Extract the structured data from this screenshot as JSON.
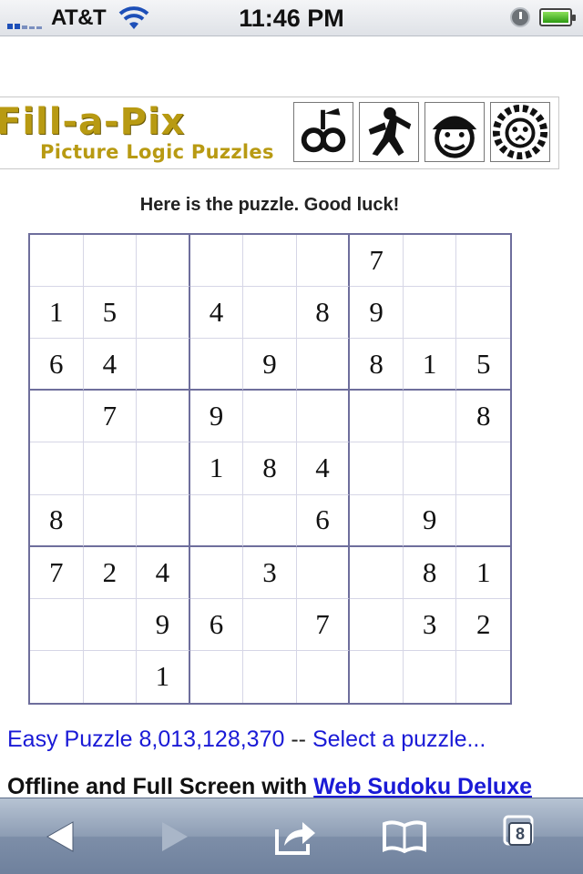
{
  "status_bar": {
    "carrier": "AT&T",
    "time": "11:46 PM",
    "signal_icon": "signal-bars-icon",
    "wifi_icon": "wifi-icon",
    "alarm_icon": "alarm-clock-icon",
    "battery_icon": "battery-icon",
    "battery_level": 1.0
  },
  "banner": {
    "logo_title": "Fill-a-Pix",
    "logo_subtitle": "Picture Logic Puzzles",
    "thumbnails": [
      "puzzle-thumb-fruit",
      "puzzle-thumb-figure",
      "puzzle-thumb-face",
      "puzzle-thumb-lion"
    ]
  },
  "intro_text": "Here is the puzzle. Good luck!",
  "sudoku": {
    "rows": [
      [
        "",
        "",
        "",
        "",
        "",
        "",
        "7",
        "",
        ""
      ],
      [
        "1",
        "5",
        "",
        "4",
        "",
        "8",
        "9",
        "",
        ""
      ],
      [
        "6",
        "4",
        "",
        "",
        "9",
        "",
        "8",
        "1",
        "5"
      ],
      [
        "",
        "7",
        "",
        "9",
        "",
        "",
        "",
        "",
        "8"
      ],
      [
        "",
        "",
        "",
        "1",
        "8",
        "4",
        "",
        "",
        ""
      ],
      [
        "8",
        "",
        "",
        "",
        "",
        "6",
        "",
        "9",
        ""
      ],
      [
        "7",
        "2",
        "4",
        "",
        "3",
        "",
        "",
        "8",
        "1"
      ],
      [
        "",
        "",
        "9",
        "6",
        "",
        "7",
        "",
        "3",
        "2"
      ],
      [
        "",
        "",
        "1",
        "",
        "",
        "",
        "",
        "",
        ""
      ]
    ]
  },
  "puzzle_info": {
    "level_label": "Easy Puzzle 8,013,128,370",
    "separator": " -- ",
    "select_link": "Select a puzzle..."
  },
  "promo": {
    "text": "Offline and Full Screen with ",
    "link": "Web Sudoku Deluxe"
  },
  "toolbar": {
    "back_icon": "back-arrow-icon",
    "forward_icon": "forward-arrow-icon",
    "share_icon": "share-icon",
    "bookmarks_icon": "bookmarks-book-icon",
    "tabs_icon": "tabs-pages-icon",
    "tab_count": "8",
    "colors": {
      "bar": "#8d9db4",
      "icon": "#ffffff",
      "disabled_icon": "#a9b6c8"
    }
  },
  "colors": {
    "grid_border": "#6e6e9c",
    "link": "#1a1ad6",
    "logo": "#b89a12"
  }
}
